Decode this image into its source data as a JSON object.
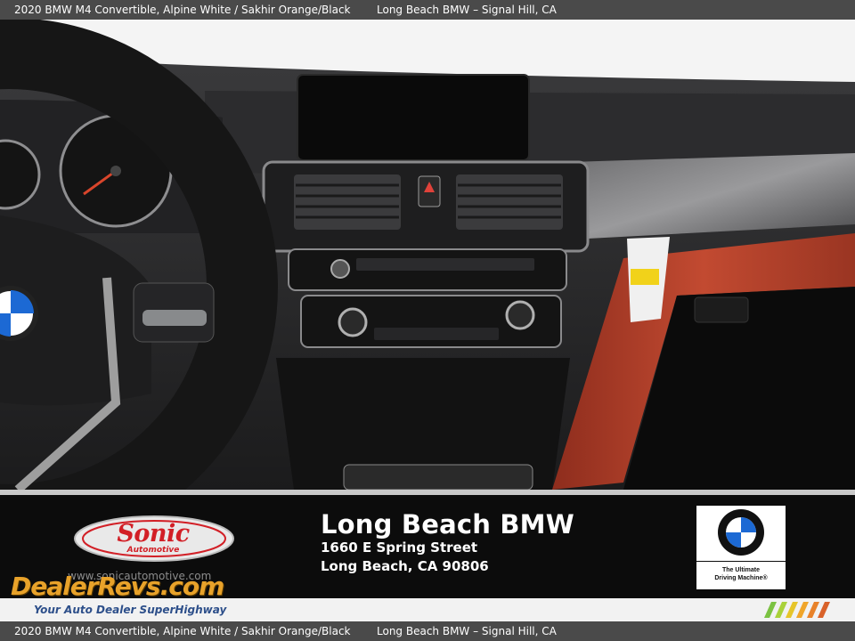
{
  "top_caption": {
    "vehicle": "2020 BMW M4 Convertible,  Alpine White / Sakhir Orange/Black",
    "dealer": "Long Beach BMW – Signal Hill, CA"
  },
  "bottom_caption": {
    "vehicle": "2020 BMW M4 Convertible,  Alpine White / Sakhir Orange/Black",
    "dealer": "Long Beach BMW – Signal Hill, CA"
  },
  "dealer_banner": {
    "name": "Long Beach BMW",
    "street": "1660 E Spring Street",
    "city": "Long Beach, CA 90806",
    "sonic_logo_text": "Sonic",
    "sonic_logo_sub": "Automotive",
    "url": "www.sonicautomotive.com",
    "bmw_slogan_line1": "The Ultimate",
    "bmw_slogan_line2": "Driving Machine®"
  },
  "watermark": {
    "brand": "DealerRevs.com",
    "tagline": "Your Auto Dealer SuperHighway"
  },
  "colors": {
    "caption_bar": "#4a4a4a",
    "interior_orange": "#b9432c",
    "sonic_red": "#d21f26",
    "watermark_gold": "#e8a22a"
  }
}
